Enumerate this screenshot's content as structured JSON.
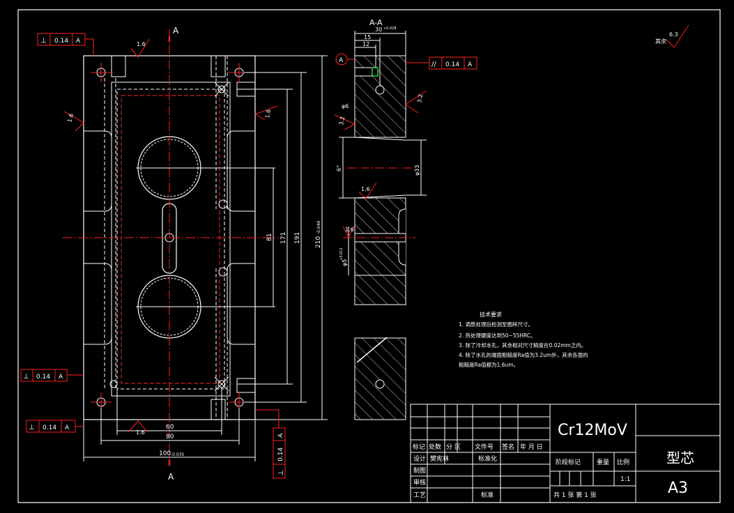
{
  "section_label": "A-A",
  "section_marker": "A",
  "datum_label": "A",
  "tolerances": {
    "perp_top": {
      "symbol": "⊥",
      "value": "0.14",
      "datum": "A"
    },
    "perp_left": {
      "symbol": "⊥",
      "value": "0.14",
      "datum": "A"
    },
    "perp_bottom": {
      "symbol": "⊥",
      "value": "0.14",
      "datum": "A"
    },
    "perp_vertical": {
      "symbol": "⊥",
      "value": "0.14",
      "datum": "A"
    },
    "parallel_right": {
      "symbol": "//",
      "value": "0.14",
      "datum": "A"
    }
  },
  "roughness": {
    "r_top": "1.6",
    "r_left": "1.6",
    "r_right": "1.6",
    "r_bottom": "1.6",
    "r_sec_a": "3.2",
    "r_sec_b": "3.2",
    "r_sec_c": "1.6",
    "r_sec_d": "1.6",
    "r_global": "6.3",
    "r_global_label": "其余"
  },
  "dimensions": {
    "d60": "60",
    "d80": "80",
    "d100": "100",
    "d100_tol": "-0.035",
    "d81": "81",
    "d171": "171",
    "d191": "191",
    "d210": "210",
    "d210_tol": "-0.044",
    "s30": "30",
    "s30_tol": "+0.028",
    "s15": "15",
    "s12": "12",
    "phi6": "φ6",
    "phi33": "φ33",
    "angle6": "6°",
    "phi5": "φ5",
    "phi5_tol": "+0.012"
  },
  "tech": {
    "title": "技术要求",
    "items": [
      "1. 调质处理后检测至图样尺寸。",
      "2. 热处理硬度达到50~55HRC。",
      "3. 除了冷却水孔，其余相对尺寸精度在0.02mm之内。",
      "4. 除了水孔的端面粗糙度Ra值为3.2um外，其余各面的",
      "粗糙度Ra值都为1.6um。"
    ]
  },
  "title_block": {
    "material": "Cr12MoV",
    "part_name": "型芯",
    "sheet_size": "A3",
    "scale": "1:1",
    "sheet_count": "共 1 张  第 1 张",
    "h_mark": "标记",
    "h_count": "处数",
    "h_zone": "分  区",
    "h_docno": "文件号",
    "h_sign": "签名",
    "h_date": "年 月 日",
    "designer_label": "设计",
    "designer": "樊宪林",
    "standard_label": "标准化",
    "drawing": "制图",
    "check": "审核",
    "process": "工艺",
    "approve": "标准",
    "stage_mark": "阶段标记",
    "weight": "重量",
    "ratio": "比例"
  }
}
